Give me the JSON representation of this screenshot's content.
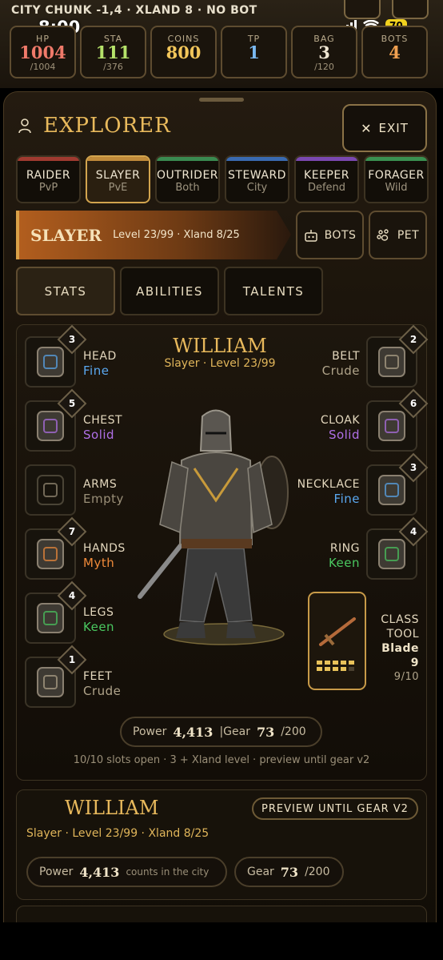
{
  "status": {
    "location": "CITY CHUNK -1,4 · XLAND 8 · NO BOT",
    "time": "8:00",
    "battery": "70"
  },
  "stats": [
    {
      "label": "HP",
      "value": "1004",
      "max": "/1004",
      "color": "#f07a6a"
    },
    {
      "label": "STA",
      "value": "111",
      "max": "/376",
      "color": "#b6e36a"
    },
    {
      "label": "COINS",
      "value": "800",
      "max": "",
      "color": "#f2c65a"
    },
    {
      "label": "TP",
      "value": "1",
      "max": "",
      "color": "#7ab8f0"
    },
    {
      "label": "BAG",
      "value": "3",
      "max": "/120",
      "color": "#efe6d2"
    },
    {
      "label": "BOTS",
      "value": "4",
      "max": "",
      "color": "#f0a050"
    }
  ],
  "header": {
    "title": "EXPLORER",
    "exit_label": "EXIT"
  },
  "classes": [
    {
      "name": "RAIDER",
      "sub": "PvP",
      "color": "#a03a30"
    },
    {
      "name": "SLAYER",
      "sub": "PvE",
      "color": "#c08a3a"
    },
    {
      "name": "OUTRIDER",
      "sub": "Both",
      "color": "#3a8a50"
    },
    {
      "name": "STEWARD",
      "sub": "City",
      "color": "#3a6ab0"
    },
    {
      "name": "KEEPER",
      "sub": "Defend",
      "color": "#7a48b0"
    },
    {
      "name": "FORAGER",
      "sub": "Wild",
      "color": "#3a9050"
    }
  ],
  "banner": {
    "class_name": "SLAYER",
    "level_info": "Level 23/99 · Xland 8/25",
    "bots_label": "BOTS",
    "pet_label": "PET"
  },
  "tabs": [
    "STATS",
    "ABILITIES",
    "TALENTS"
  ],
  "hero": {
    "name": "WILLIAM",
    "subtitle": "Slayer · Level 23/99"
  },
  "slots_left": [
    {
      "name": "HEAD",
      "quality": "Fine",
      "tier": "3",
      "color": "#5aa8f0"
    },
    {
      "name": "CHEST",
      "quality": "Solid",
      "tier": "5",
      "color": "#b070e8"
    },
    {
      "name": "ARMS",
      "quality": "Empty",
      "tier": "",
      "color": "#9a8f78"
    },
    {
      "name": "HANDS",
      "quality": "Myth",
      "tier": "7",
      "color": "#f08a3a"
    },
    {
      "name": "LEGS",
      "quality": "Keen",
      "tier": "4",
      "color": "#4ac860"
    },
    {
      "name": "FEET",
      "quality": "Crude",
      "tier": "1",
      "color": "#b0a48a"
    }
  ],
  "slots_right": [
    {
      "name": "BELT",
      "quality": "Crude",
      "tier": "2",
      "color": "#b0a48a"
    },
    {
      "name": "CLOAK",
      "quality": "Solid",
      "tier": "6",
      "color": "#b070e8"
    },
    {
      "name": "NECKLACE",
      "quality": "Fine",
      "tier": "3",
      "color": "#5aa8f0"
    },
    {
      "name": "RING",
      "quality": "Keen",
      "tier": "4",
      "color": "#4ac860"
    }
  ],
  "class_tool": {
    "label_1": "CLASS",
    "label_2": "TOOL",
    "name": "Blade 9",
    "progress": "9/10"
  },
  "summary": {
    "power_label": "Power",
    "power_value": "4,413",
    "gear_label": "|Gear",
    "gear_value": "73",
    "gear_max": "/200",
    "note": "10/10 slots open · 3 + Xland level · preview until gear v2"
  },
  "card": {
    "name": "WILLIAM",
    "preview_label": "PREVIEW UNTIL GEAR V2",
    "subtitle": "Slayer · Level 23/99 · Xland 8/25",
    "power_label": "Power",
    "power_value": "4,413",
    "power_note": "counts in the city",
    "gear_label": "Gear",
    "gear_value": "73",
    "gear_max": "/200"
  }
}
